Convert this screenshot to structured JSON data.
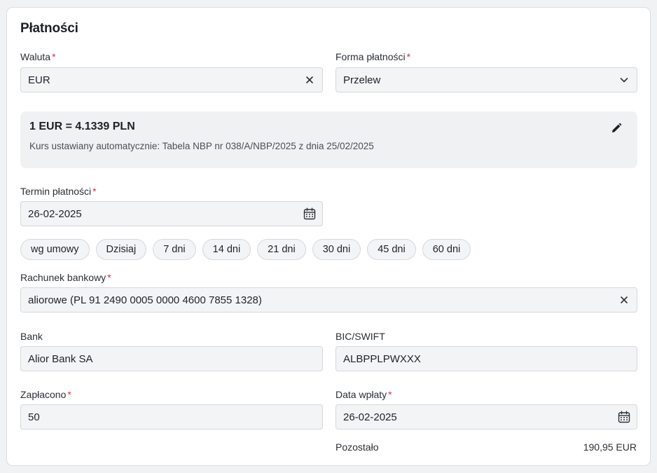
{
  "section": {
    "title": "Płatności"
  },
  "currency": {
    "label": "Waluta",
    "required_mark": "*",
    "value": "EUR"
  },
  "payment_method": {
    "label": "Forma płatności",
    "required_mark": "*",
    "value": "Przelew"
  },
  "exchange_rate": {
    "rate_text": "1 EUR = 4.1339 PLN",
    "note": "Kurs ustawiany automatycznie: Tabela NBP nr 038/A/NBP/2025 z dnia 25/02/2025"
  },
  "due_date": {
    "label": "Termin płatności",
    "required_mark": "*",
    "value": "26-02-2025"
  },
  "quick_terms": [
    "wg umowy",
    "Dzisiaj",
    "7 dni",
    "14 dni",
    "21 dni",
    "30 dni",
    "45 dni",
    "60 dni"
  ],
  "bank_account": {
    "label": "Rachunek bankowy",
    "required_mark": "*",
    "value": "aliorowe (PL 91 2490 0005 0000 4600 7855 1328)"
  },
  "bank": {
    "label": "Bank",
    "value": "Alior Bank SA"
  },
  "bic": {
    "label": "BIC/SWIFT",
    "value": "ALBPPLPWXXX"
  },
  "paid": {
    "label": "Zapłacono",
    "required_mark": "*",
    "value": "50"
  },
  "payment_date": {
    "label": "Data wpłaty",
    "required_mark": "*",
    "value": "26-02-2025"
  },
  "remaining": {
    "label": "Pozostało",
    "value": "190,95 EUR"
  },
  "colors": {
    "required": "#d9303b",
    "field_bg": "#f3f4f6",
    "panel_bg": "#f0f1f3"
  }
}
